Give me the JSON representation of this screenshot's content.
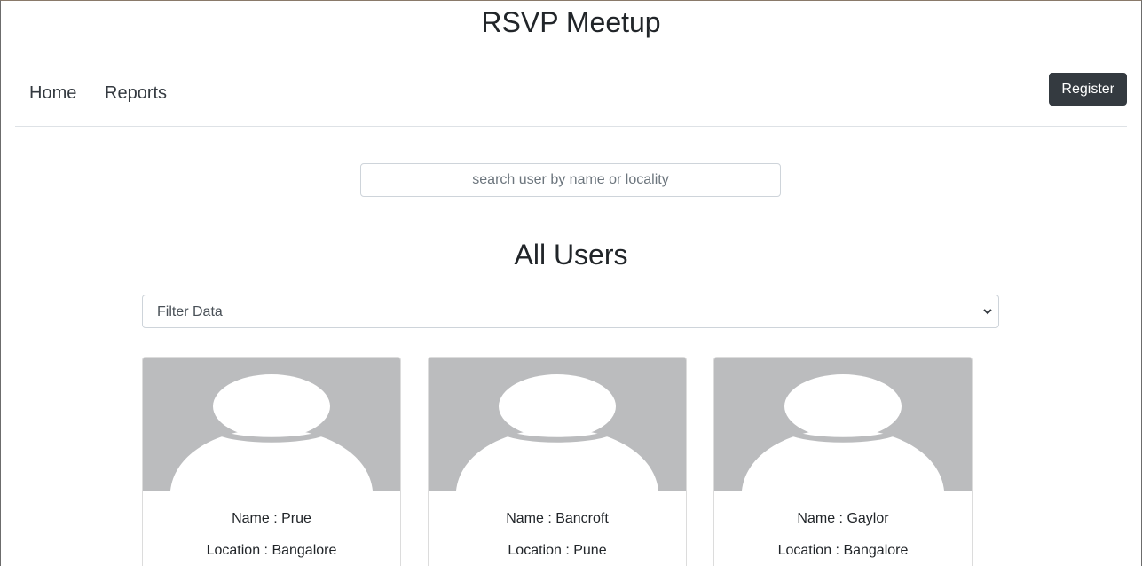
{
  "app": {
    "title": "RSVP Meetup"
  },
  "nav": {
    "home": "Home",
    "reports": "Reports",
    "register": "Register"
  },
  "search": {
    "placeholder": "search user by name or locality"
  },
  "section": {
    "title": "All Users"
  },
  "filter": {
    "selected": "Filter Data"
  },
  "users": [
    {
      "name": "Name : Prue",
      "location": "Location : Bangalore"
    },
    {
      "name": "Name : Bancroft",
      "location": "Location : Pune"
    },
    {
      "name": "Name : Gaylor",
      "location": "Location : Bangalore"
    }
  ],
  "colors": {
    "accent_dark": "#343a40",
    "avatar_bg": "#bbbcbe",
    "avatar_fg": "#ffffff"
  }
}
